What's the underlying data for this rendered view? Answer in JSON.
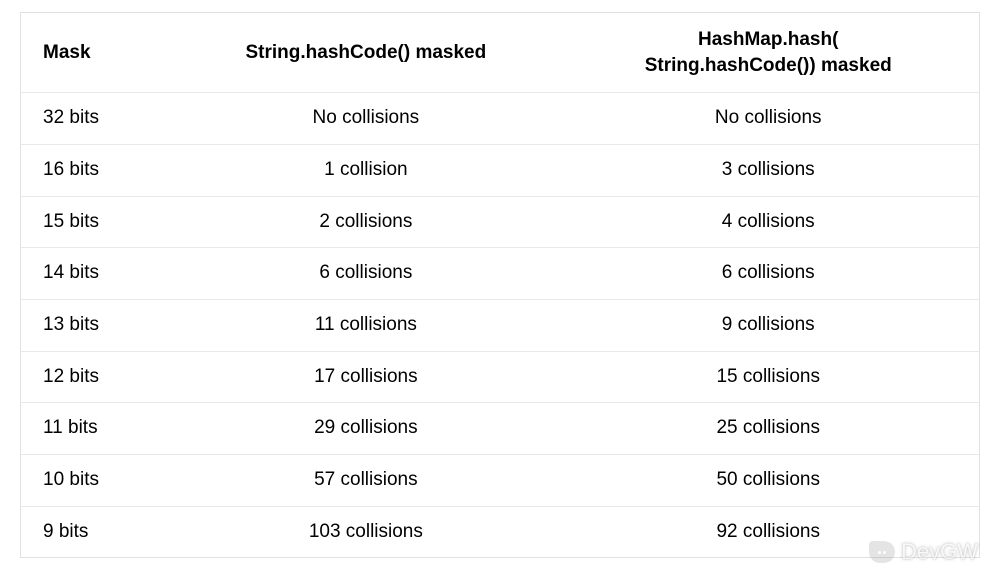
{
  "table": {
    "headers": {
      "mask": "Mask",
      "col2": "String.hashCode() masked",
      "col3_line1": "HashMap.hash(",
      "col3_line2": "String.hashCode()) masked"
    },
    "rows": [
      {
        "mask": "32 bits",
        "c2": "No collisions",
        "c3": "No collisions"
      },
      {
        "mask": "16 bits",
        "c2": "1 collision",
        "c3": "3 collisions"
      },
      {
        "mask": "15 bits",
        "c2": "2 collisions",
        "c3": "4 collisions"
      },
      {
        "mask": "14 bits",
        "c2": "6 collisions",
        "c3": "6 collisions"
      },
      {
        "mask": "13 bits",
        "c2": "11 collisions",
        "c3": "9 collisions"
      },
      {
        "mask": "12 bits",
        "c2": "17 collisions",
        "c3": "15 collisions"
      },
      {
        "mask": "11 bits",
        "c2": "29 collisions",
        "c3": "25 collisions"
      },
      {
        "mask": "10 bits",
        "c2": "57 collisions",
        "c3": "50 collisions"
      },
      {
        "mask": "9 bits",
        "c2": "103 collisions",
        "c3": "92 collisions"
      }
    ]
  },
  "watermark": {
    "text": "DevGW"
  }
}
